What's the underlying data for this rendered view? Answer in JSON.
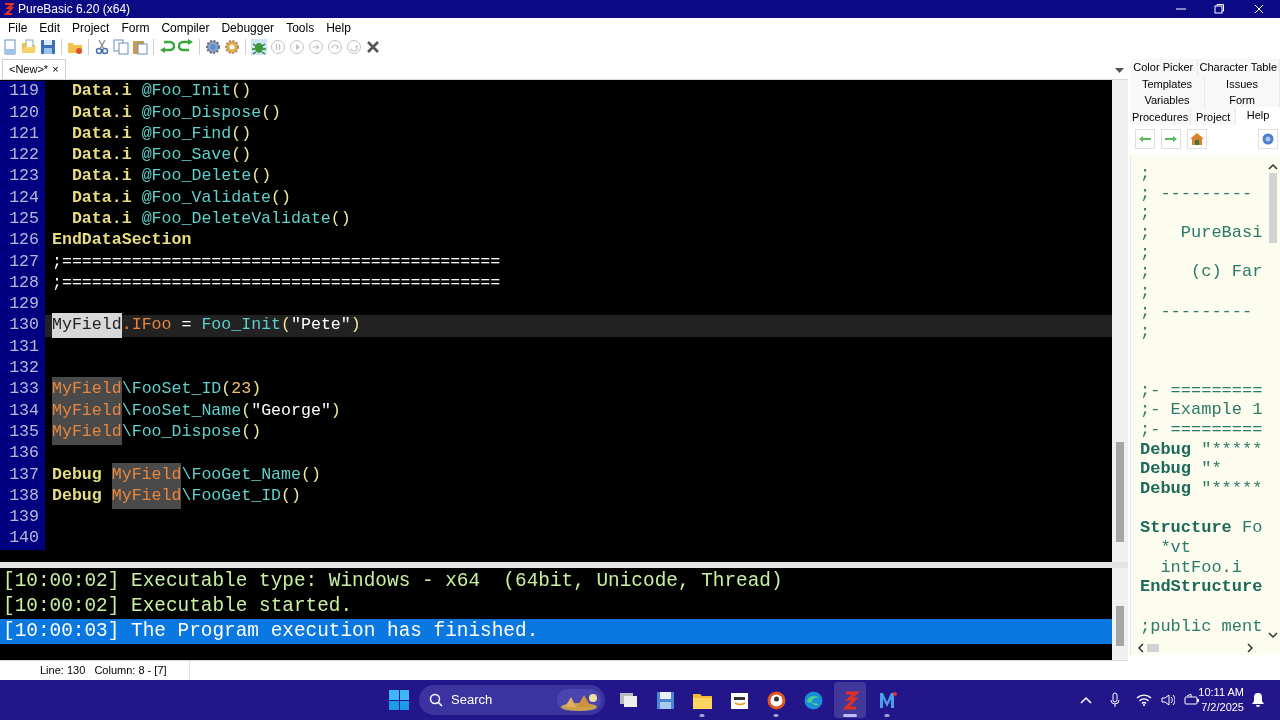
{
  "window": {
    "title": "PureBasic 6.20 (x64)"
  },
  "menu": [
    "File",
    "Edit",
    "Project",
    "Form",
    "Compiler",
    "Debugger",
    "Tools",
    "Help"
  ],
  "toolbar": [
    {
      "kind": "new",
      "disabled": false
    },
    {
      "kind": "open",
      "disabled": false
    },
    {
      "kind": "save",
      "disabled": false
    },
    {
      "kind": "sep"
    },
    {
      "kind": "project",
      "disabled": false
    },
    {
      "kind": "sep"
    },
    {
      "kind": "cut",
      "disabled": false
    },
    {
      "kind": "copy",
      "disabled": false
    },
    {
      "kind": "paste",
      "disabled": false
    },
    {
      "kind": "sep"
    },
    {
      "kind": "undo",
      "disabled": false
    },
    {
      "kind": "redo",
      "disabled": false
    },
    {
      "kind": "sep"
    },
    {
      "kind": "compile",
      "disabled": false
    },
    {
      "kind": "options",
      "disabled": false
    },
    {
      "kind": "sep"
    },
    {
      "kind": "debug",
      "disabled": false
    },
    {
      "kind": "pause",
      "disabled": true
    },
    {
      "kind": "play",
      "disabled": true
    },
    {
      "kind": "step",
      "disabled": true
    },
    {
      "kind": "stepover",
      "disabled": true
    },
    {
      "kind": "stepout",
      "disabled": true
    },
    {
      "kind": "kill",
      "disabled": false
    }
  ],
  "file_tabs": [
    {
      "label": "<New>*",
      "close": "×",
      "selected": true
    }
  ],
  "editor": {
    "lines": [
      {
        "number": "119",
        "current": false,
        "tokens": [
          {
            "text": "  Data.i",
            "kind": "kw"
          },
          {
            "text": " @Foo_Init",
            "kind": "fn"
          },
          {
            "text": "()",
            "kind": "paren"
          }
        ]
      },
      {
        "number": "120",
        "current": false,
        "tokens": [
          {
            "text": "  Data.i",
            "kind": "kw"
          },
          {
            "text": " @Foo_Dispose",
            "kind": "fn"
          },
          {
            "text": "()",
            "kind": "paren"
          }
        ]
      },
      {
        "number": "121",
        "current": false,
        "tokens": [
          {
            "text": "  Data.i",
            "kind": "kw"
          },
          {
            "text": " @Foo_Find",
            "kind": "fn"
          },
          {
            "text": "()",
            "kind": "paren"
          }
        ]
      },
      {
        "number": "122",
        "current": false,
        "tokens": [
          {
            "text": "  Data.i",
            "kind": "kw"
          },
          {
            "text": " @Foo_Save",
            "kind": "fn"
          },
          {
            "text": "()",
            "kind": "paren"
          }
        ]
      },
      {
        "number": "123",
        "current": false,
        "tokens": [
          {
            "text": "  Data.i",
            "kind": "kw"
          },
          {
            "text": " @Foo_Delete",
            "kind": "fn"
          },
          {
            "text": "()",
            "kind": "paren"
          }
        ]
      },
      {
        "number": "124",
        "current": false,
        "tokens": [
          {
            "text": "  Data.i",
            "kind": "kw"
          },
          {
            "text": " @Foo_Validate",
            "kind": "fn"
          },
          {
            "text": "()",
            "kind": "paren"
          }
        ]
      },
      {
        "number": "125",
        "current": false,
        "tokens": [
          {
            "text": "  Data.i",
            "kind": "kw"
          },
          {
            "text": " @Foo_DeleteValidate",
            "kind": "fn"
          },
          {
            "text": "()",
            "kind": "paren"
          }
        ]
      },
      {
        "number": "126",
        "current": false,
        "tokens": [
          {
            "text": "EndDataSection",
            "kind": "kw"
          }
        ]
      },
      {
        "number": "127",
        "current": false,
        "tokens": [
          {
            "text": ";============================================",
            "kind": "comment"
          }
        ]
      },
      {
        "number": "128",
        "current": false,
        "tokens": [
          {
            "text": ";============================================",
            "kind": "comment"
          }
        ]
      },
      {
        "number": "129",
        "current": false
      },
      {
        "number": "130",
        "current": true,
        "tokens": [
          {
            "text": "MyField",
            "kind": "sel"
          },
          {
            "text": ".IFoo",
            "kind": "var"
          },
          {
            "text": " = ",
            "kind": "op"
          },
          {
            "text": "Foo_Init",
            "kind": "fn"
          },
          {
            "text": "(",
            "kind": "paren"
          },
          {
            "text": "\"Pete\"",
            "kind": "str"
          },
          {
            "text": ")",
            "kind": "paren"
          }
        ]
      },
      {
        "number": "131",
        "current": false
      },
      {
        "number": "132",
        "current": false
      },
      {
        "number": "133",
        "current": false,
        "tokens": [
          {
            "text": "MyField",
            "kind": "varhl"
          },
          {
            "text": "\\FooSet_ID",
            "kind": "fn"
          },
          {
            "text": "(",
            "kind": "paren"
          },
          {
            "text": "23",
            "kind": "num"
          },
          {
            "text": ")",
            "kind": "paren"
          }
        ]
      },
      {
        "number": "134",
        "current": false,
        "tokens": [
          {
            "text": "MyField",
            "kind": "varhl"
          },
          {
            "text": "\\FooSet_Name",
            "kind": "fn"
          },
          {
            "text": "(",
            "kind": "paren"
          },
          {
            "text": "\"George\"",
            "kind": "str"
          },
          {
            "text": ")",
            "kind": "paren"
          }
        ]
      },
      {
        "number": "135",
        "current": false,
        "tokens": [
          {
            "text": "MyField",
            "kind": "varhl"
          },
          {
            "text": "\\Foo_Dispose",
            "kind": "fn"
          },
          {
            "text": "()",
            "kind": "paren"
          }
        ]
      },
      {
        "number": "136",
        "current": false
      },
      {
        "number": "137",
        "current": false,
        "tokens": [
          {
            "text": "Debug ",
            "kind": "kw"
          },
          {
            "text": "MyField",
            "kind": "varhl"
          },
          {
            "text": "\\FooGet_Name",
            "kind": "fn"
          },
          {
            "text": "()",
            "kind": "paren"
          }
        ]
      },
      {
        "number": "138",
        "current": false,
        "tokens": [
          {
            "text": "Debug ",
            "kind": "kw"
          },
          {
            "text": "MyField",
            "kind": "varhl"
          },
          {
            "text": "\\FooGet_ID",
            "kind": "fn"
          },
          {
            "text": "()",
            "kind": "paren"
          }
        ]
      },
      {
        "number": "139",
        "current": false
      },
      {
        "number": "140",
        "current": false
      }
    ]
  },
  "output": [
    {
      "text": "[10:00:02] Executable type: Windows - x64  (64bit, Unicode, Thread)",
      "selected": false
    },
    {
      "text": "[10:00:02] Executable started.",
      "selected": false
    },
    {
      "text": "[10:00:03] The Program execution has finished.",
      "selected": true
    }
  ],
  "status_bar": {
    "position": "Line: 130   Column: 8 - [7]"
  },
  "tool_tabs": [
    [
      {
        "label": "Color Picker",
        "selected": false
      },
      {
        "label": "Character Table",
        "selected": false
      }
    ],
    [
      {
        "label": "Templates",
        "selected": false
      },
      {
        "label": "Issues",
        "selected": false
      }
    ],
    [
      {
        "label": "Variables",
        "selected": false
      },
      {
        "label": "Form",
        "selected": false
      }
    ],
    [
      {
        "label": "Procedures",
        "selected": false
      },
      {
        "label": "Project",
        "selected": false
      },
      {
        "label": "Help",
        "selected": true
      }
    ]
  ],
  "help_view": {
    "lines": [
      [
        {
          "text": ";",
          "kind": "comment"
        }
      ],
      [
        {
          "text": "; ---------",
          "kind": "comment"
        }
      ],
      [
        {
          "text": ";",
          "kind": "comment"
        }
      ],
      [
        {
          "text": ";   PureBasi",
          "kind": "comment"
        }
      ],
      [
        {
          "text": ";",
          "kind": "comment"
        }
      ],
      [
        {
          "text": ";    (c) Far",
          "kind": "comment"
        }
      ],
      [
        {
          "text": ";",
          "kind": "comment"
        }
      ],
      [
        {
          "text": "; ---------",
          "kind": "comment"
        }
      ],
      [
        {
          "text": ";",
          "kind": "comment"
        }
      ],
      {
        "kind": "blank"
      },
      {
        "kind": "blank"
      },
      [
        {
          "text": ";- =========",
          "kind": "comment"
        }
      ],
      [
        {
          "text": ";- Example 1",
          "kind": "comment"
        }
      ],
      [
        {
          "text": ";- =========",
          "kind": "comment"
        }
      ],
      [
        {
          "text": "Debug",
          "kind": "kw"
        },
        {
          "text": " \"*****",
          "kind": "comment"
        }
      ],
      [
        {
          "text": "Debug",
          "kind": "kw"
        },
        {
          "text": " \"*",
          "kind": "comment"
        }
      ],
      [
        {
          "text": "Debug",
          "kind": "kw"
        },
        {
          "text": " \"*****",
          "kind": "comment"
        }
      ],
      {
        "kind": "blank"
      },
      [
        {
          "text": "Structure",
          "kind": "kw"
        },
        {
          "text": " Fo",
          "kind": "comment"
        }
      ],
      [
        {
          "text": "  *vt",
          "kind": "comment"
        }
      ],
      [
        {
          "text": "  intFoo.i",
          "kind": "comment"
        }
      ],
      [
        {
          "text": "EndStructure",
          "kind": "kw"
        }
      ],
      {
        "kind": "blank"
      },
      [
        {
          "text": ";public ment",
          "kind": "comment"
        }
      ]
    ]
  },
  "taskbar": {
    "search": {
      "placeholder": "Search"
    },
    "apps": [
      {
        "kind": "taskview",
        "running": false,
        "active": false
      },
      {
        "kind": "save",
        "running": false,
        "active": false
      },
      {
        "kind": "files",
        "running": true,
        "active": false
      },
      {
        "kind": "amazon",
        "running": false,
        "active": false
      },
      {
        "kind": "duck",
        "running": true,
        "active": false
      },
      {
        "kind": "edge",
        "running": false,
        "active": false
      },
      {
        "kind": "purebasic",
        "running": true,
        "active": true
      },
      {
        "kind": "m",
        "running": true,
        "active": false
      }
    ],
    "time": "10:11 AM",
    "date": "7/2/2025"
  }
}
